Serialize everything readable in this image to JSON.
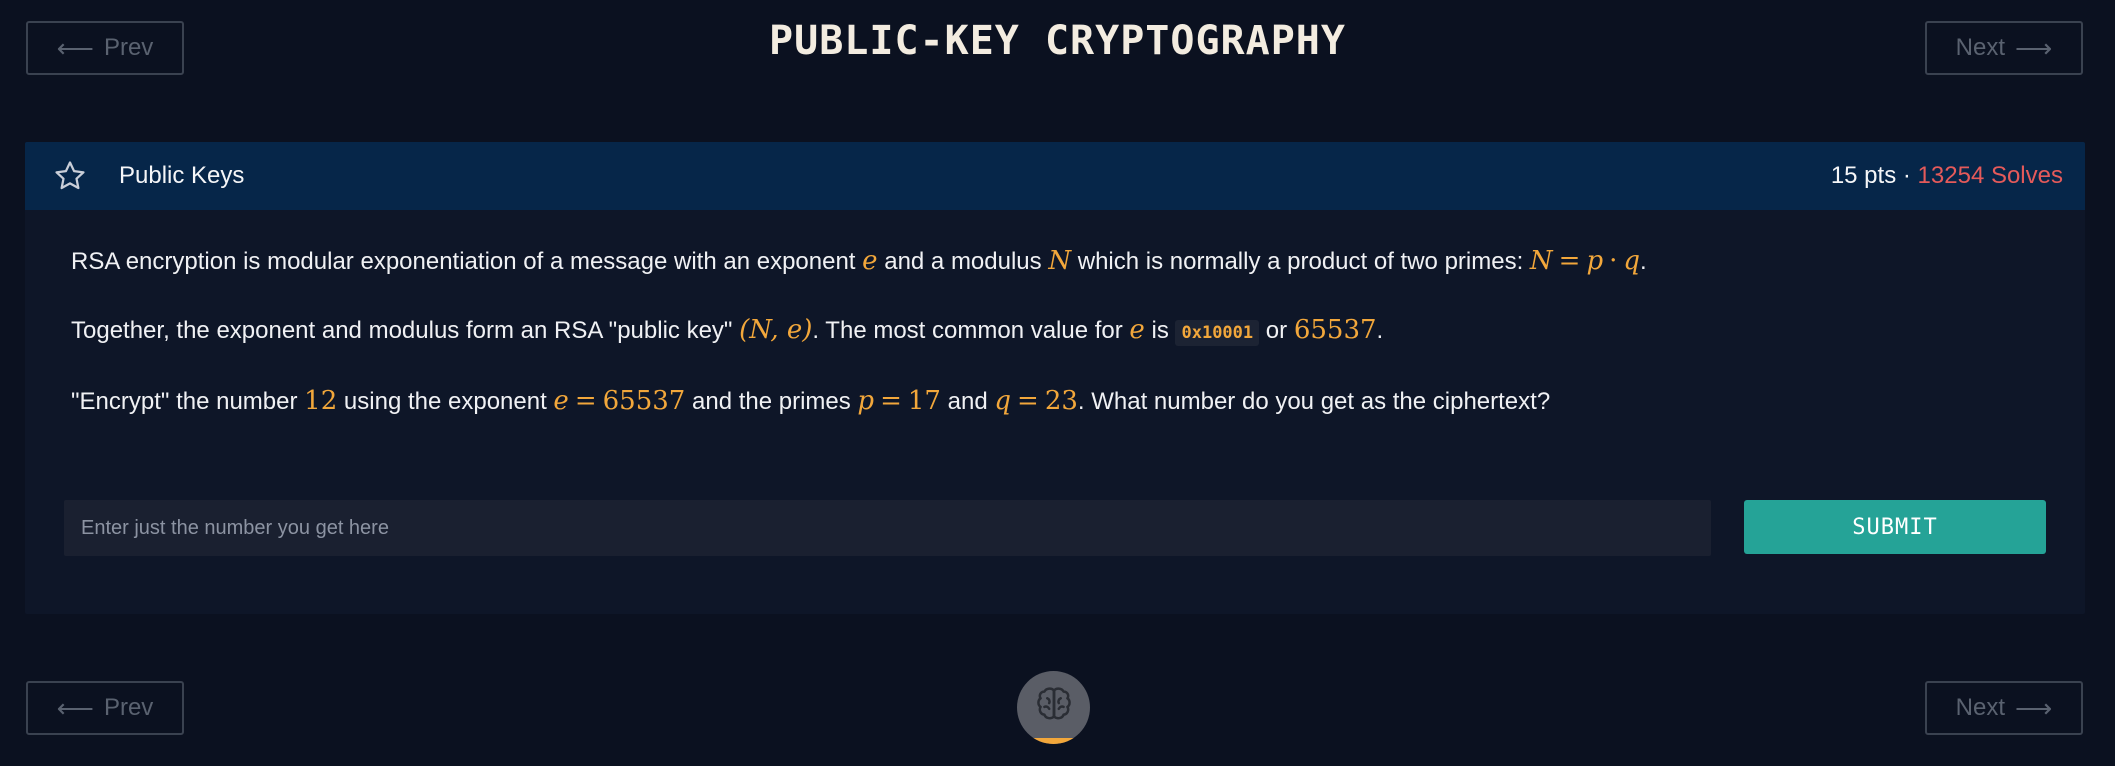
{
  "nav": {
    "prev_label": "Prev",
    "next_label": "Next",
    "prev_arrow": "⟵",
    "next_arrow": "⟶"
  },
  "page_title": "PUBLIC-KEY CRYPTOGRAPHY",
  "challenge": {
    "name": "Public Keys",
    "points": "15 pts",
    "separator": "·",
    "solves": "13254 Solves",
    "star_icon": "star-outline-icon",
    "paragraphs": {
      "p1": {
        "t1": "RSA encryption is modular exponentiation of a message with an exponent ",
        "m1": "e",
        "t2": " and a modulus ",
        "m2": "N",
        "t3": " which is normally a product of two primes: ",
        "m3a": "N",
        "m3op": "=",
        "m3b": "p",
        "m3dot": "·",
        "m3c": "q",
        "t4": "."
      },
      "p2": {
        "t1": "Together, the exponent and modulus form an RSA \"public key\" ",
        "m1": "(N, e)",
        "t2": ". The most common value for ",
        "m2": "e",
        "t3": " is ",
        "code": "0x10001",
        "t4": " or ",
        "m3": "65537",
        "t5": "."
      },
      "p3": {
        "t1": "\"Encrypt\" the number ",
        "m1": "12",
        "t2": " using the exponent ",
        "m2a": "e",
        "m2op": "=",
        "m2b": "65537",
        "t3": " and the primes ",
        "m3a": "p",
        "m3op": "=",
        "m3b": "17",
        "t4": " and ",
        "m4a": "q",
        "m4op": "=",
        "m4b": "23",
        "t5": ". What number do you get as the ciphertext?"
      }
    },
    "answer": {
      "placeholder": "Enter just the number you get here",
      "value": "",
      "submit_label": "SUBMIT"
    }
  },
  "badge": {
    "icon": "brain-icon",
    "progress_fraction": 0.08
  },
  "colors": {
    "background": "#0b1120",
    "header": "#062649",
    "accent_math": "#f2a73b",
    "solves": "#e45a5a",
    "submit": "#25a397"
  }
}
